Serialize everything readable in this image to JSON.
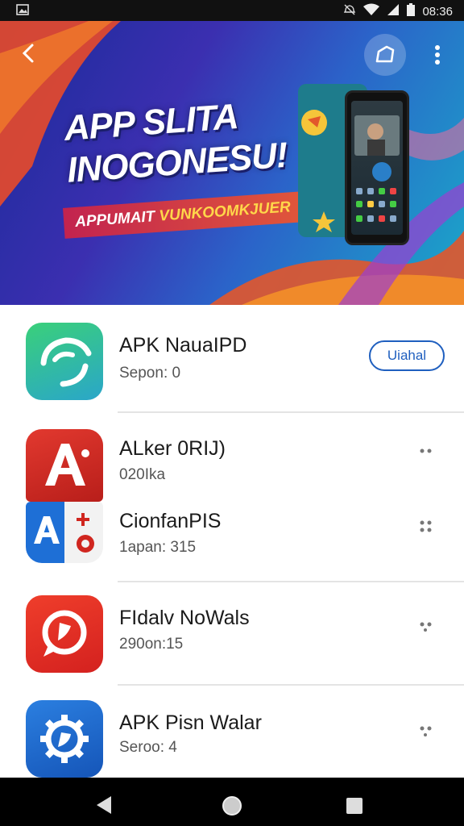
{
  "status_bar": {
    "time": "08:36"
  },
  "banner": {
    "headline_line1": "APP SLITA",
    "headline_line2": "INOGONESU!",
    "ribbon_left": "APPUMAIT ",
    "ribbon_right": "VUNKOOMKJUER"
  },
  "apps": [
    {
      "title": "APK NauaIPD",
      "subtitle": "Sepon: 0",
      "action_label": "Uiahal",
      "icon": "phone-swirl-icon",
      "color": "#2ec4a0"
    },
    {
      "title": "ALker 0RIJ)",
      "subtitle": "020Ika",
      "icon": "letter-a-icon",
      "color": "#d0261f"
    },
    {
      "title": "CionfanPIS",
      "subtitle": "1apan: 315",
      "icon": "a-plus-icon",
      "color": "#1e6fd6"
    },
    {
      "title": "FIdalv NoWals",
      "subtitle": "290on:15",
      "icon": "chat-bubble-icon",
      "color": "#e53026"
    },
    {
      "title": "APK Pisn Walar",
      "subtitle": "Seroo: 4",
      "icon": "gear-icon",
      "color": "#1762c9"
    }
  ],
  "nav_bar": {
    "back": "back-icon",
    "home": "home-icon",
    "recents": "recents-icon"
  }
}
